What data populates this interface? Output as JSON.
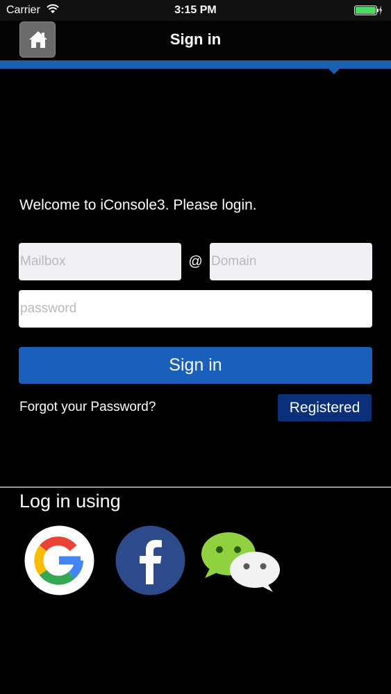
{
  "status_bar": {
    "carrier": "Carrier",
    "time": "3:15 PM",
    "icons": [
      "wifi-icon",
      "battery-icon",
      "charging-bolt-icon"
    ],
    "battery_color": "#4cd964"
  },
  "navbar": {
    "title": "Sign in",
    "home_icon": "home-icon",
    "accent_color": "#1a5fb0"
  },
  "login": {
    "welcome": "Welcome to iConsole3. Please login.",
    "mailbox_placeholder": "Mailbox",
    "at_sign": "@",
    "domain_placeholder": "Domain",
    "password_placeholder": "password",
    "signin_label": "Sign in",
    "forgot_label": "Forgot your Password?",
    "registered_label": "Registered"
  },
  "social": {
    "heading": "Log in using",
    "providers": [
      "google-icon",
      "facebook-icon",
      "wechat-icon"
    ]
  }
}
